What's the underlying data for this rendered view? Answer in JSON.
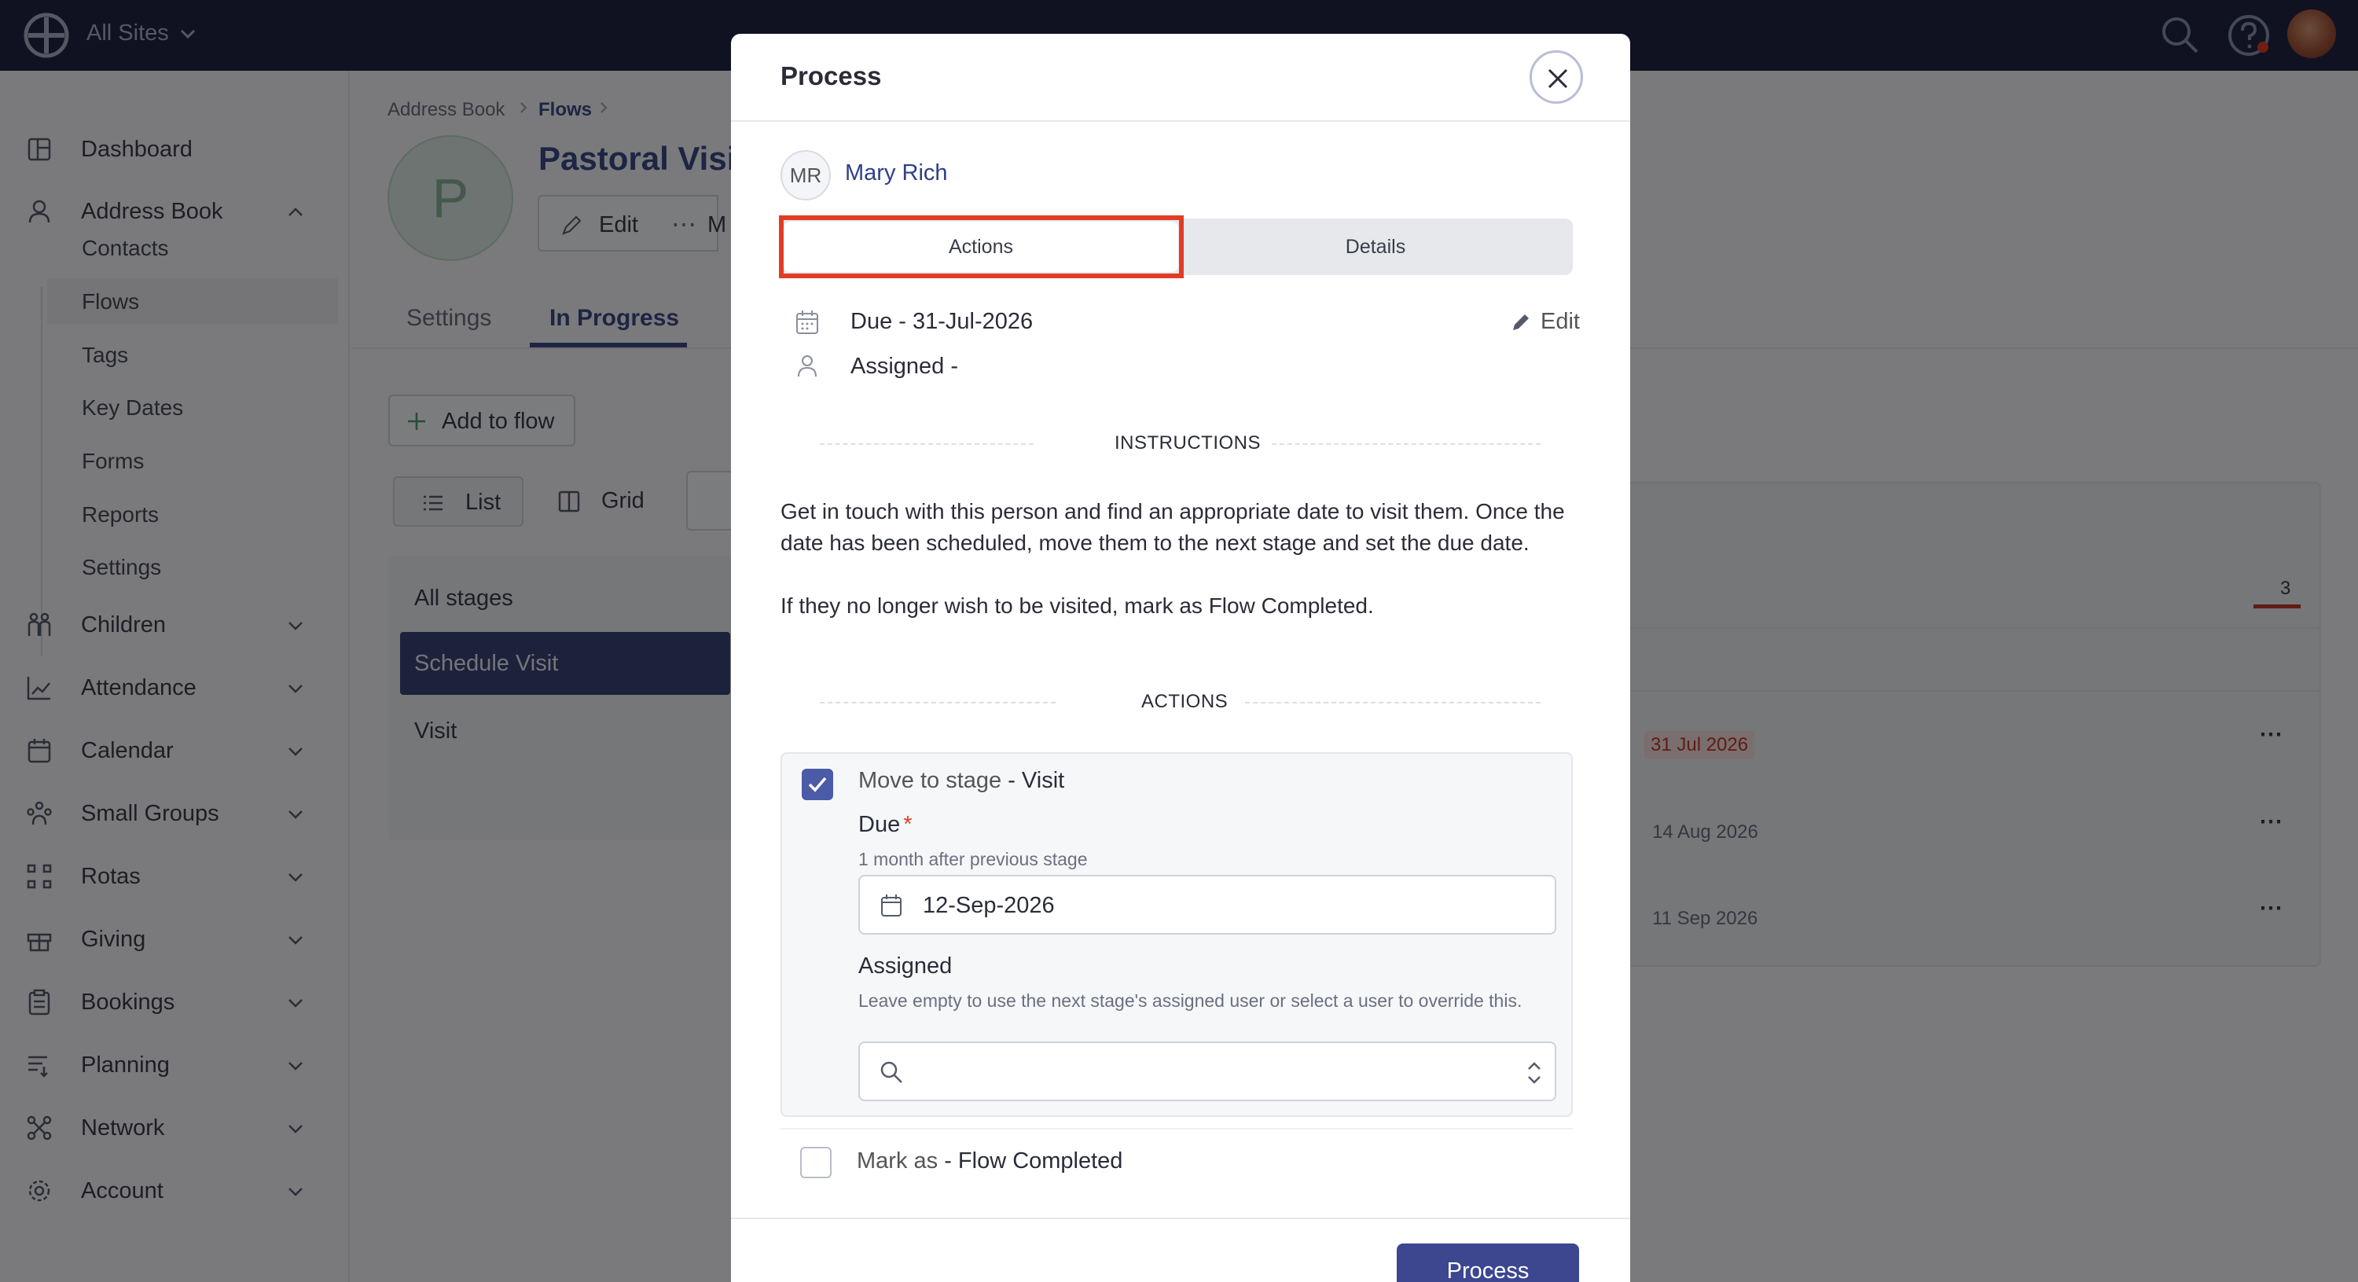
{
  "topbar": {
    "sites_label": "All Sites"
  },
  "sidebar": {
    "items": [
      {
        "label": "Dashboard",
        "icon": "dashboard-icon"
      },
      {
        "label": "Address Book",
        "icon": "person-icon"
      },
      {
        "label": "Children",
        "icon": "children-icon"
      },
      {
        "label": "Attendance",
        "icon": "chart-icon"
      },
      {
        "label": "Calendar",
        "icon": "calendar-icon"
      },
      {
        "label": "Small Groups",
        "icon": "group-icon"
      },
      {
        "label": "Rotas",
        "icon": "rotas-icon"
      },
      {
        "label": "Giving",
        "icon": "gift-icon"
      },
      {
        "label": "Bookings",
        "icon": "clipboard-icon"
      },
      {
        "label": "Planning",
        "icon": "planning-icon"
      },
      {
        "label": "Network",
        "icon": "network-icon"
      },
      {
        "label": "Account",
        "icon": "gear-icon"
      }
    ],
    "sub_items": [
      "Contacts",
      "Flows",
      "Tags",
      "Key Dates",
      "Forms",
      "Reports",
      "Settings"
    ]
  },
  "page": {
    "breadcrumb": [
      "Address Book",
      "Flows"
    ],
    "avatar_letter": "P",
    "title": "Pastoral Visit",
    "edit_label": "Edit",
    "more_dots": "⋯",
    "more_letter": "M",
    "tabs": [
      "Settings",
      "In Progress"
    ],
    "add_label": "Add to flow",
    "view_list": "List",
    "view_grid": "Grid",
    "stages": [
      "All stages",
      "Schedule Visit",
      "Visit"
    ],
    "count": "3",
    "row_dates": [
      "31 Jul 2026",
      "14 Aug 2026",
      "11 Sep 2026"
    ],
    "row_more": "⋯"
  },
  "modal": {
    "title": "Process",
    "person": {
      "initials": "MR",
      "name": "Mary Rich"
    },
    "tabs": {
      "actions": "Actions",
      "details": "Details"
    },
    "due_text": "Due - 31-Jul-2026",
    "assigned_text": "Assigned -",
    "edit_label": "Edit",
    "instructions_heading": "INSTRUCTIONS",
    "instructions_p1": "Get in touch with this person and find an appropriate date to visit them. Once the date has been scheduled, move them to the next stage and set the due date.",
    "instructions_p2": "If they no longer wish to be visited, mark as Flow Completed.",
    "actions_heading": "ACTIONS",
    "move": {
      "prefix": "Move to stage",
      "stage": " - Visit",
      "checked": true,
      "due_label": "Due",
      "required_mark": "*",
      "due_help": "1 month after previous stage",
      "due_value": "12-Sep-2026",
      "assigned_label": "Assigned",
      "assigned_help": "Leave empty to use the next stage's assigned user or select a user to override this."
    },
    "mark": {
      "prefix": "Mark as",
      "value": " - Flow Completed",
      "checked": false
    },
    "process_button": "Process"
  },
  "colors": {
    "topbar": "#202543",
    "primary": "#3c4790",
    "highlight": "#e13d25"
  }
}
